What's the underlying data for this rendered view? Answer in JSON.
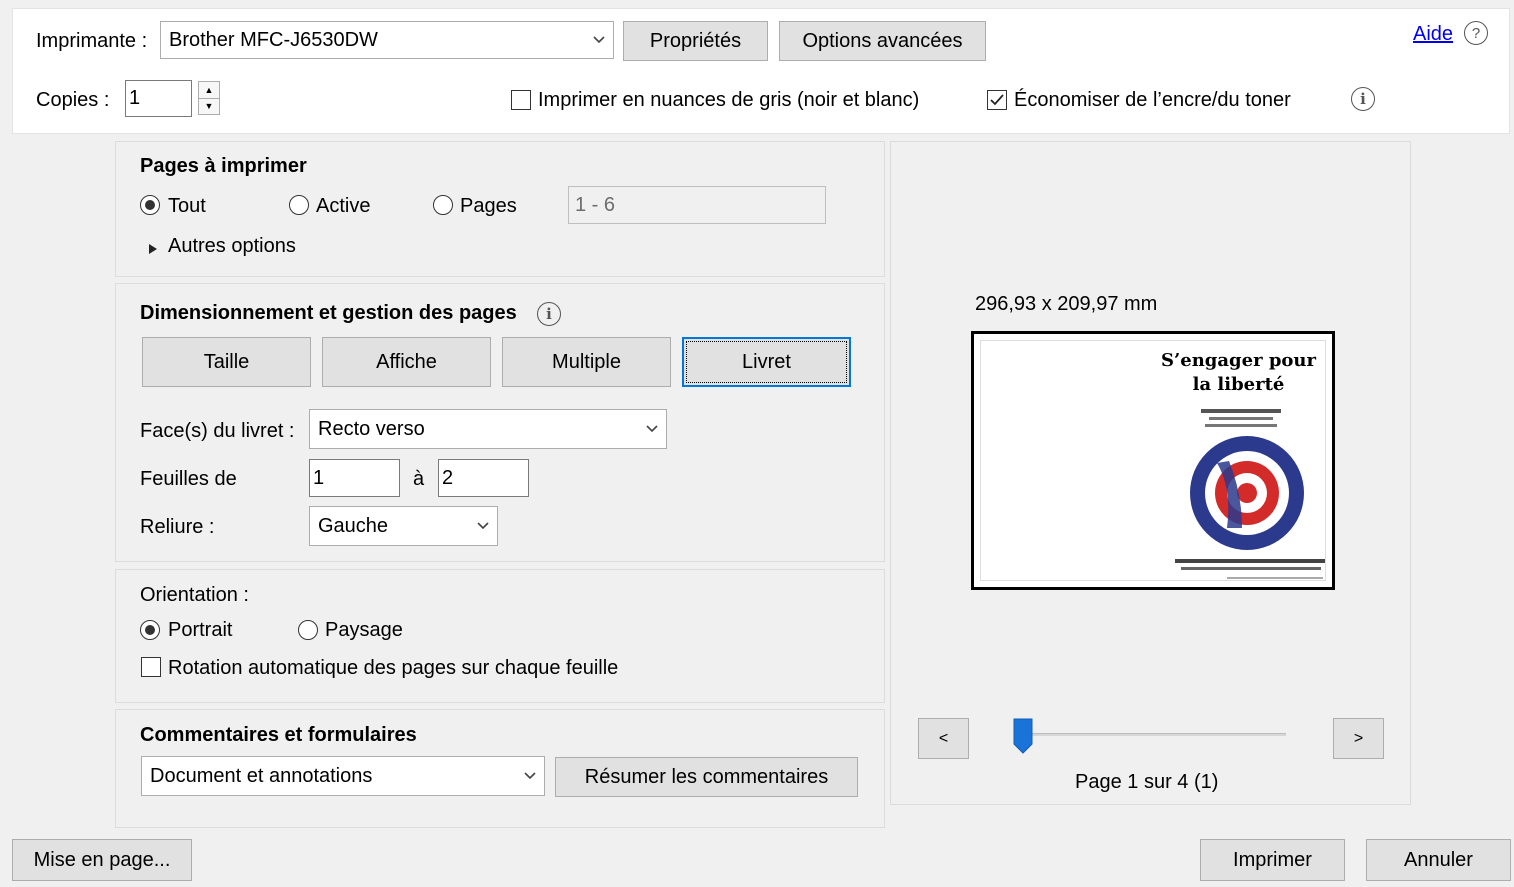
{
  "header": {
    "printer_label": "Imprimante :",
    "printer_value": "Brother MFC-J6530DW",
    "properties_button": "Propriétés",
    "advanced_button": "Options avancées",
    "help_link": "Aide",
    "copies_label": "Copies :",
    "copies_value": "1",
    "grayscale_label": "Imprimer en nuances de gris (noir et blanc)",
    "grayscale_checked": false,
    "save_ink_label": "Économiser de l’encre/du toner",
    "save_ink_checked": true
  },
  "pages": {
    "title": "Pages à imprimer",
    "option_all": "Tout",
    "option_active": "Active",
    "option_pages": "Pages",
    "selected": "Tout",
    "pages_range": "1 - 6",
    "more_options": "Autres options"
  },
  "sizing": {
    "title": "Dimensionnement et gestion des pages",
    "tabs": [
      {
        "label": "Taille"
      },
      {
        "label": "Affiche"
      },
      {
        "label": "Multiple"
      },
      {
        "label": "Livret"
      }
    ],
    "active_tab": "Livret",
    "sides_label": "Face(s) du livret :",
    "sides_value": "Recto verso",
    "sheets_label": "Feuilles de",
    "sheets_from": "1",
    "sheets_to_label": "à",
    "sheets_to": "2",
    "binding_label": "Reliure :",
    "binding_value": "Gauche"
  },
  "orientation": {
    "title": "Orientation :",
    "portrait": "Portrait",
    "landscape": "Paysage",
    "selected": "Portrait",
    "auto_rotate": "Rotation automatique des pages sur chaque feuille",
    "auto_rotate_checked": false
  },
  "comments": {
    "title": "Commentaires et formulaires",
    "select_value": "Document et annotations",
    "summarize_button": "Résumer les commentaires"
  },
  "preview": {
    "dimensions": "296,93 x 209,97 mm",
    "page_title_line1": "S’engager pour",
    "page_title_line2": "la liberté",
    "prev_button": "<",
    "next_button": ">",
    "page_status": "Page 1 sur 4 (1)",
    "slider_position": 0
  },
  "footer": {
    "page_setup_button": "Mise en page...",
    "print_button": "Imprimer",
    "cancel_button": "Annuler"
  },
  "icons": {
    "dropdown": "chevron-down-icon",
    "info": "info-icon",
    "help": "help-icon",
    "expand": "triangle-right-icon"
  },
  "colors": {
    "focus_accent": "#0078d7",
    "slider_thumb": "#1a73d9",
    "link": "#0000ee"
  }
}
